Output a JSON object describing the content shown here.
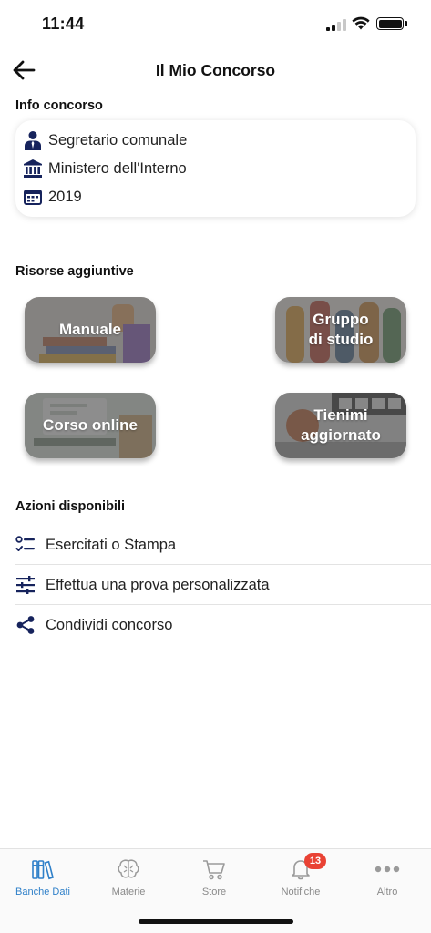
{
  "status_bar": {
    "time": "11:44"
  },
  "header": {
    "title": "Il Mio Concorso"
  },
  "info": {
    "section_title": "Info concorso",
    "rows": [
      {
        "icon": "person-tie-icon",
        "text": "Segretario comunale"
      },
      {
        "icon": "institution-icon",
        "text": "Ministero dell'Interno"
      },
      {
        "icon": "calendar-icon",
        "text": "2019"
      }
    ]
  },
  "resources": {
    "section_title": "Risorse aggiuntive",
    "tiles": [
      {
        "label": "Manuale"
      },
      {
        "label": "Gruppo\ndi studio"
      },
      {
        "label": "Corso online"
      },
      {
        "label": "Tienimi\naggiornato"
      }
    ]
  },
  "actions": {
    "section_title": "Azioni disponibili",
    "items": [
      {
        "icon": "checklist-icon",
        "label": "Esercitati o Stampa"
      },
      {
        "icon": "sliders-icon",
        "label": "Effettua una prova personalizzata"
      },
      {
        "icon": "share-icon",
        "label": "Condividi concorso"
      }
    ]
  },
  "tab_bar": {
    "active_color": "#2f80c9",
    "tabs": [
      {
        "label": "Banche Dati",
        "icon": "books-icon",
        "active": true
      },
      {
        "label": "Materie",
        "icon": "brain-icon",
        "active": false
      },
      {
        "label": "Store",
        "icon": "cart-icon",
        "active": false
      },
      {
        "label": "Notifiche",
        "icon": "bell-icon",
        "active": false,
        "badge": "13"
      },
      {
        "label": "Altro",
        "icon": "more-dots-icon",
        "active": false
      }
    ]
  }
}
